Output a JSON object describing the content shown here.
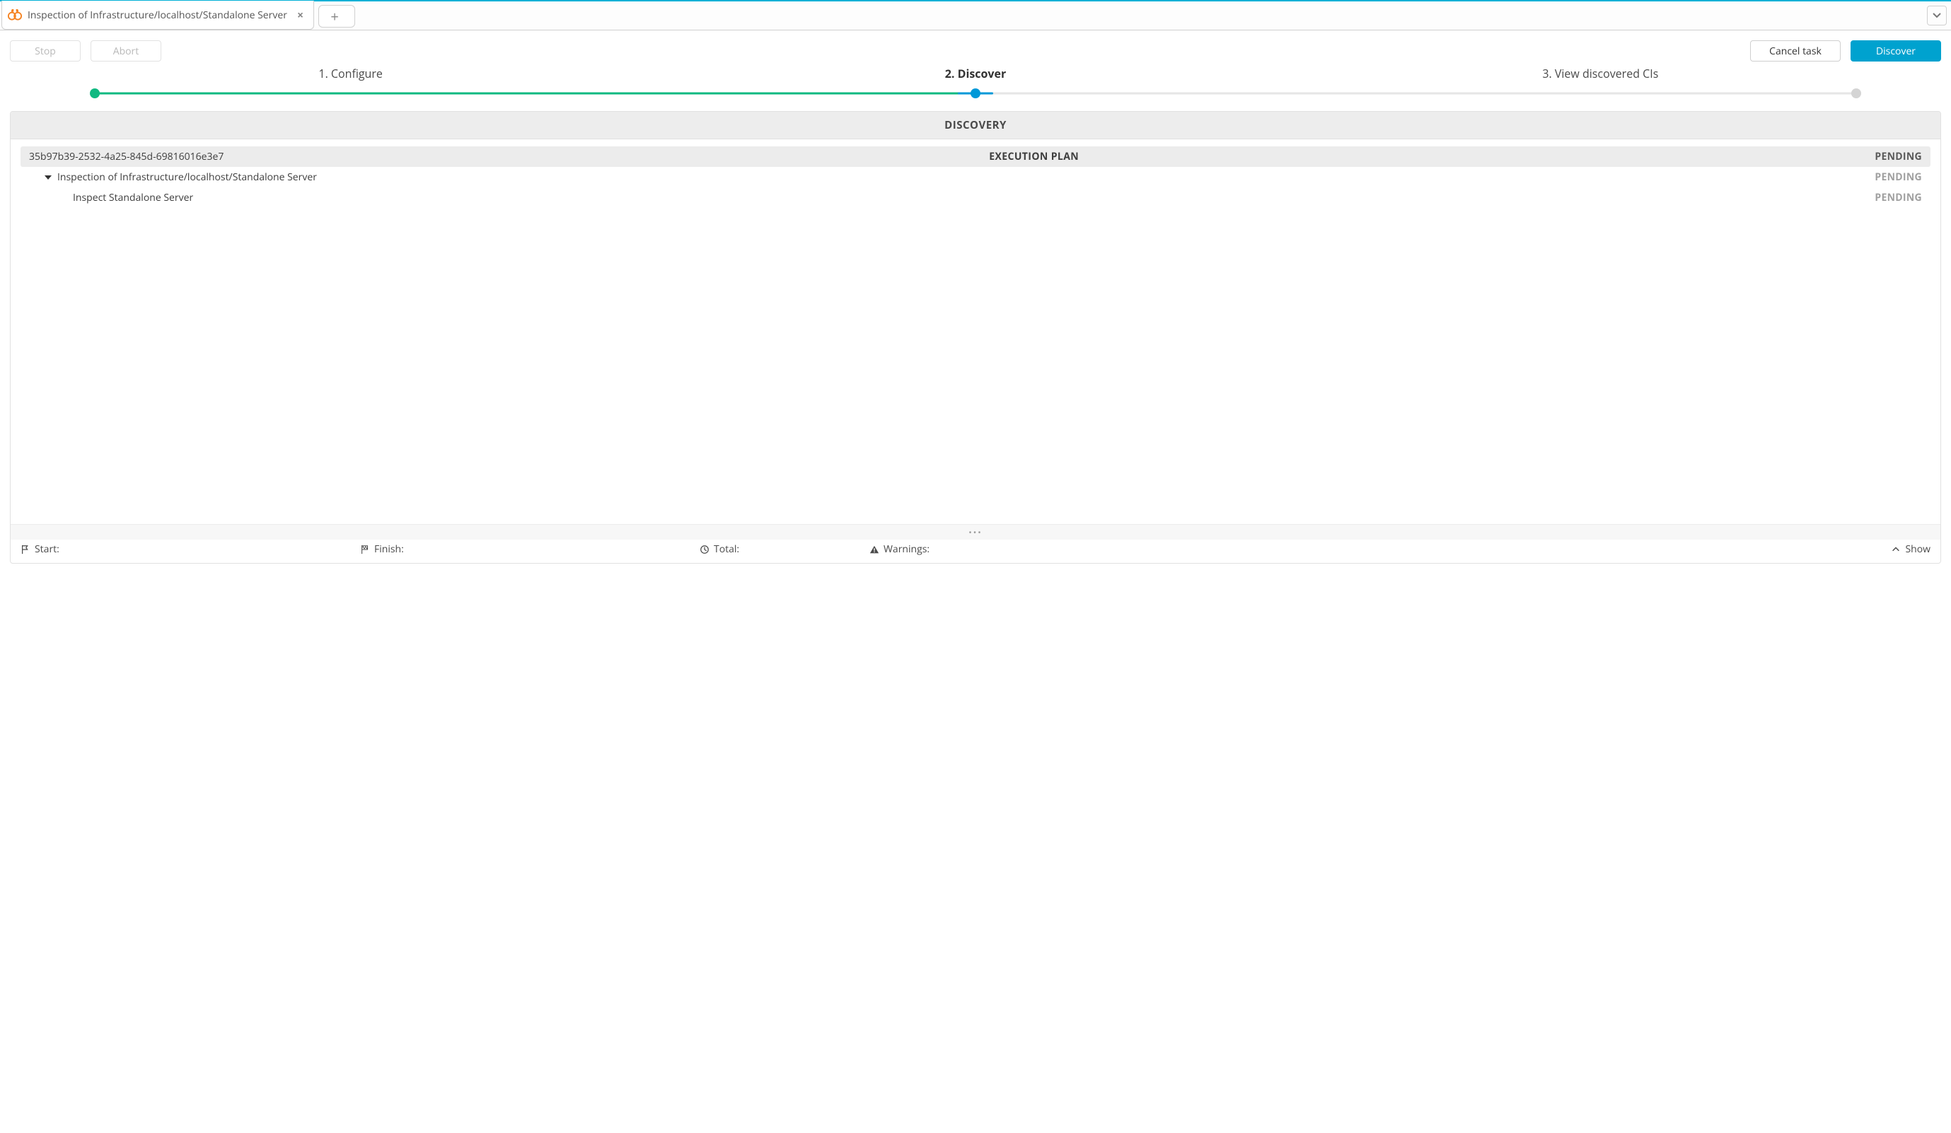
{
  "tabs": {
    "active_title": "Inspection of Infrastructure/localhost/Standalone Server"
  },
  "toolbar": {
    "stop": "Stop",
    "abort": "Abort",
    "cancel_task": "Cancel task",
    "discover": "Discover"
  },
  "steps": {
    "s1": "1. Configure",
    "s2": "2. Discover",
    "s3": "3. View discovered CIs",
    "active_index": 1
  },
  "panel": {
    "title": "DISCOVERY",
    "plan": {
      "id": "35b97b39-2532-4a25-845d-69816016e3e7",
      "label": "EXECUTION PLAN",
      "status": "PENDING"
    },
    "tree": [
      {
        "indent": 1,
        "expandable": true,
        "label": "Inspection of Infrastructure/localhost/Standalone Server",
        "status": "PENDING"
      },
      {
        "indent": 2,
        "expandable": false,
        "label": "Inspect Standalone Server",
        "status": "PENDING"
      }
    ]
  },
  "statusbar": {
    "start": "Start:",
    "finish": "Finish:",
    "total": "Total:",
    "warnings": "Warnings:",
    "show": "Show"
  }
}
